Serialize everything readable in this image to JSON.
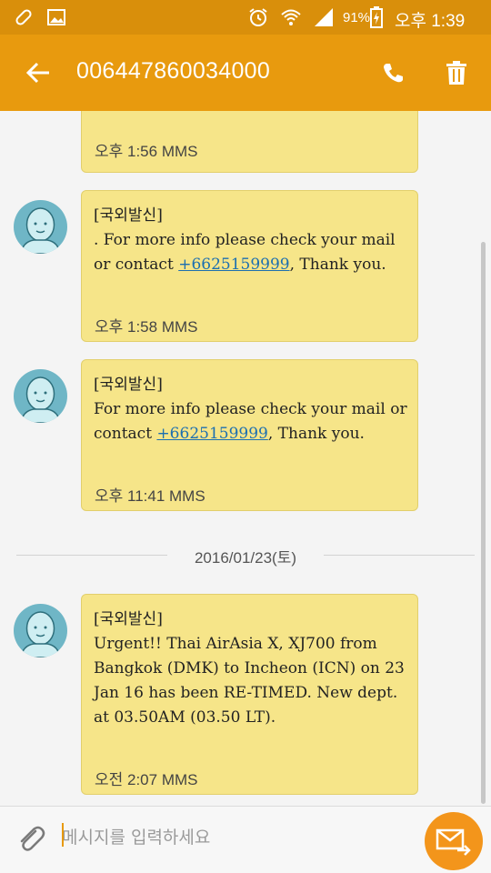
{
  "status_bar": {
    "battery": "91%",
    "time": "오후 1:39"
  },
  "app_bar": {
    "title": "006447860034000"
  },
  "messages": [
    {
      "text_parts": [],
      "meta": "오후 1:56 MMS"
    },
    {
      "prefix": "[국외발신]",
      "line_before": ". For more info please check your mail or contact ",
      "phone": "+6625159999",
      "line_after": ", Thank you.",
      "meta": "오후 1:58 MMS"
    },
    {
      "prefix": "[국외발신]",
      "line_before": "For more info please check your mail or contact ",
      "phone": "+6625159999",
      "line_after": ", Thank you.",
      "meta": "오후 11:41 MMS"
    },
    {
      "prefix": "[국외발신]",
      "body": "Urgent!! Thai AirAsia X, XJ700 from Bangkok (DMK) to Incheon (ICN) on 23 Jan 16 has been RE-TIMED. New dept. at 03.50AM (03.50 LT).",
      "meta": "오전 2:07 MMS"
    }
  ],
  "date_separator": "2016/01/23(토)",
  "input": {
    "placeholder": "메시지를 입력하세요"
  },
  "colors": {
    "status_bar": "#d98f0b",
    "app_bar": "#e89a0e",
    "bubble": "#f6e589",
    "send_button": "#f3951b",
    "link": "#1c6fb0"
  },
  "icons": {
    "back": "arrow-left-icon",
    "call": "phone-icon",
    "delete": "trash-icon",
    "attach": "paperclip-icon",
    "send": "envelope-arrow-icon"
  }
}
